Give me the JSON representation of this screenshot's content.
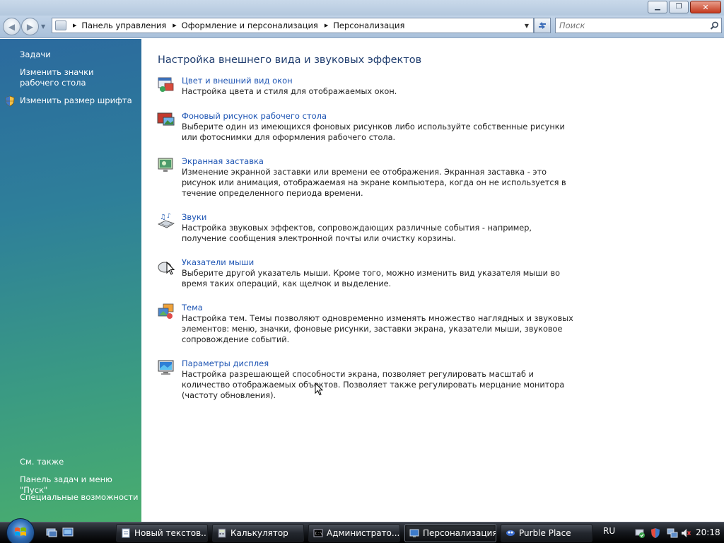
{
  "window": {
    "minimize_label": "▁",
    "maximize_label": "❐",
    "close_label": "✕"
  },
  "address_bar": {
    "crumbs": [
      "Панель управления",
      "Оформление и персонализация",
      "Персонализация"
    ]
  },
  "search": {
    "placeholder": "Поиск"
  },
  "left_pane": {
    "tasks_heading": "Задачи",
    "tasks": [
      {
        "label": "Изменить значки рабочего стола",
        "icon": null
      },
      {
        "label": "Изменить размер шрифта",
        "icon": "uac-shield-icon"
      }
    ],
    "see_also_heading": "См. также",
    "see_also": [
      {
        "label": "Панель задач и меню \"Пуск\""
      },
      {
        "label": "Специальные возможности"
      }
    ]
  },
  "main": {
    "title": "Настройка внешнего вида и звуковых эффектов",
    "items": [
      {
        "link": "Цвет и внешний вид окон",
        "icon": "window-color-icon",
        "desc": "Настройка цвета и стиля для отображаемых окон."
      },
      {
        "link": "Фоновый рисунок рабочего стола",
        "icon": "desktop-background-icon",
        "desc": "Выберите один из имеющихся фоновых рисунков либо используйте собственные рисунки или фотоснимки для оформления рабочего стола."
      },
      {
        "link": "Экранная заставка",
        "icon": "screensaver-icon",
        "desc": "Изменение экранной заставки или времени ее отображения. Экранная заставка - это рисунок или анимация, отображаемая на экране компьютера, когда он не используется в течение определенного периода времени."
      },
      {
        "link": "Звуки",
        "icon": "sounds-icon",
        "desc": "Настройка звуковых эффектов, сопровождающих различные события - например, получение сообщения электронной почты или очистку корзины."
      },
      {
        "link": "Указатели мыши",
        "icon": "mouse-pointer-icon",
        "desc": "Выберите другой указатель мыши. Кроме того, можно изменить вид указателя мыши во время таких операций, как щелчок и выделение."
      },
      {
        "link": "Тема",
        "icon": "theme-icon",
        "desc": "Настройка тем. Темы позволяют одновременно изменять множество наглядных и звуковых элементов: меню, значки, фоновые рисунки, заставки экрана, указатели мыши, звуковое сопровождение событий."
      },
      {
        "link": "Параметры дисплея",
        "icon": "display-settings-icon",
        "desc": "Настройка разрешающей способности экрана, позволяет регулировать масштаб и количество отображаемых объектов. Позволяет также регулировать мерцание монитора (частоту обновления)."
      }
    ]
  },
  "taskbar": {
    "tasks": [
      {
        "label": "Новый текстов...",
        "icon": "notepad-icon",
        "active": false
      },
      {
        "label": "Калькулятор",
        "icon": "calculator-icon",
        "active": false
      },
      {
        "label": "Администрато...",
        "icon": "cmd-icon",
        "active": false
      },
      {
        "label": "Персонализация",
        "icon": "control-panel-icon",
        "active": true
      },
      {
        "label": "Purble Place",
        "icon": "purble-place-icon",
        "active": false
      }
    ],
    "language": "RU",
    "clock": "20:18"
  }
}
